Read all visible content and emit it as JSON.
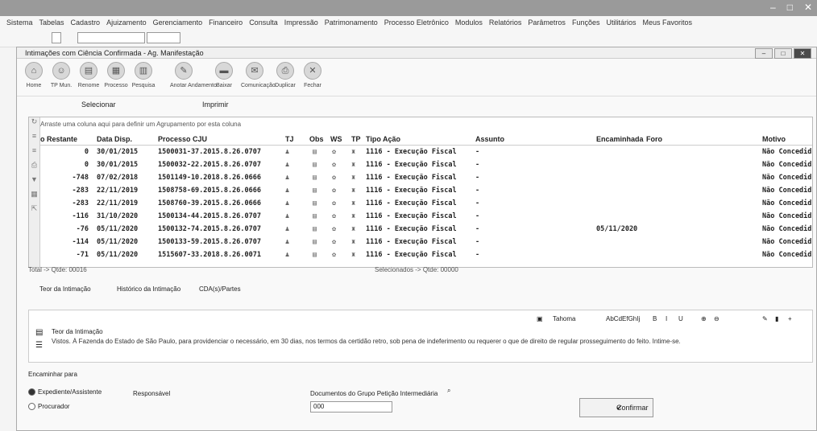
{
  "window": {
    "controls": [
      "–",
      "□",
      "✕"
    ]
  },
  "menu": [
    "Sistema",
    "Tabelas",
    "Cadastro",
    "Ajuizamento",
    "Gerenciamento",
    "Financeiro",
    "Consulta",
    "Impressão",
    "Patrimonamento",
    "Processo Eletrônico",
    "Modulos",
    "Relatórios",
    "Parâmetros",
    "Funções",
    "Utilitários",
    "Meus Favoritos"
  ],
  "child_window": {
    "title": "Intimações com Ciência Confirmada - Ag. Manifestação"
  },
  "toolbar": [
    {
      "icon": "home-icon",
      "label": "Home"
    },
    {
      "icon": "user-icon",
      "label": "TP Mun."
    },
    {
      "icon": "doc-icon",
      "label": "Renome"
    },
    {
      "icon": "folder-icon",
      "label": "Processo"
    },
    {
      "icon": "folder-icon",
      "label": "Pesquisa"
    },
    {
      "icon": "doc-icon",
      "label": "Anotar Andamento"
    },
    {
      "icon": "edit-icon",
      "label": "Baixar"
    },
    {
      "icon": "chat-icon",
      "label": "Comunicação"
    },
    {
      "icon": "print-icon",
      "label": "Duplicar"
    },
    {
      "icon": "close-icon",
      "label": "Fechar"
    }
  ],
  "selectors": {
    "select": "Selecionar",
    "print": "Imprimir"
  },
  "grid": {
    "group_hint": "Arraste uma coluna aqui para definir um Agrupamento por esta coluna",
    "columns": [
      "o Restante",
      "Data Disp.",
      "Processo CJU",
      "TJ",
      "Obs",
      "WS",
      "TP",
      "Tipo Ação",
      "Assunto",
      "Encaminhada",
      "Foro",
      "Motivo"
    ],
    "rows": [
      {
        "restante": "0",
        "data": "30/01/2015",
        "processo": "1500031-37.2015.8.26.0707",
        "tipo": "1116 - Execução Fiscal",
        "assunto": "-",
        "encaminhada": "",
        "motivo": "Não Concedid"
      },
      {
        "restante": "0",
        "data": "30/01/2015",
        "processo": "1500032-22.2015.8.26.0707",
        "tipo": "1116 - Execução Fiscal",
        "assunto": "-",
        "encaminhada": "",
        "motivo": "Não Concedid"
      },
      {
        "restante": "-748",
        "data": "07/02/2018",
        "processo": "1501149-10.2018.8.26.0666",
        "tipo": "1116 - Execução Fiscal",
        "assunto": "-",
        "encaminhada": "",
        "motivo": "Não Concedid"
      },
      {
        "restante": "-283",
        "data": "22/11/2019",
        "processo": "1508758-69.2015.8.26.0666",
        "tipo": "1116 - Execução Fiscal",
        "assunto": "-",
        "encaminhada": "",
        "motivo": "Não Concedid"
      },
      {
        "restante": "-283",
        "data": "22/11/2019",
        "processo": "1508760-39.2015.8.26.0666",
        "tipo": "1116 - Execução Fiscal",
        "assunto": "-",
        "encaminhada": "",
        "motivo": "Não Concedid"
      },
      {
        "restante": "-116",
        "data": "31/10/2020",
        "processo": "1500134-44.2015.8.26.0707",
        "tipo": "1116 - Execução Fiscal",
        "assunto": "-",
        "encaminhada": "",
        "motivo": "Não Concedid"
      },
      {
        "restante": "-76",
        "data": "05/11/2020",
        "processo": "1500132-74.2015.8.26.0707",
        "tipo": "1116 - Execução Fiscal",
        "assunto": "-",
        "encaminhada": "05/11/2020",
        "motivo": "Não Concedid"
      },
      {
        "restante": "-114",
        "data": "05/11/2020",
        "processo": "1500133-59.2015.8.26.0707",
        "tipo": "1116 - Execução Fiscal",
        "assunto": "-",
        "encaminhada": "",
        "motivo": "Não Concedid"
      },
      {
        "restante": "-71",
        "data": "05/11/2020",
        "processo": "1515607-33.2018.8.26.0071",
        "tipo": "1116 - Execução Fiscal",
        "assunto": "-",
        "encaminhada": "",
        "motivo": "Não Concedid"
      }
    ],
    "footer_total": "Total -> Qtde: 00016",
    "footer_selected": "Selecionados -> Qtde: 00000"
  },
  "tabs": [
    "Teor da Intimação",
    "Histórico da Intimação",
    "CDA(s)/Partes"
  ],
  "editor": {
    "font": "Tahoma",
    "sample": "AbCdEfGhIj"
  },
  "teor": {
    "label": "Teor da Intimação",
    "text": "Vistos. À Fazenda do Estado de São Paulo, para providenciar o necessário, em 30 dias, nos termos da certidão retro, sob pena de indeferimento ou requerer o que de direito de regular prosseguimento do feito. Intime-se."
  },
  "forward": {
    "label": "Encaminhar para",
    "option1": "Expediente/Assistente",
    "option2": "Procurador",
    "responsavel": "Responsável",
    "docs_label": "Documentos do Grupo Petição Intermediária",
    "docs_value": "000",
    "confirm": "Confirmar"
  }
}
